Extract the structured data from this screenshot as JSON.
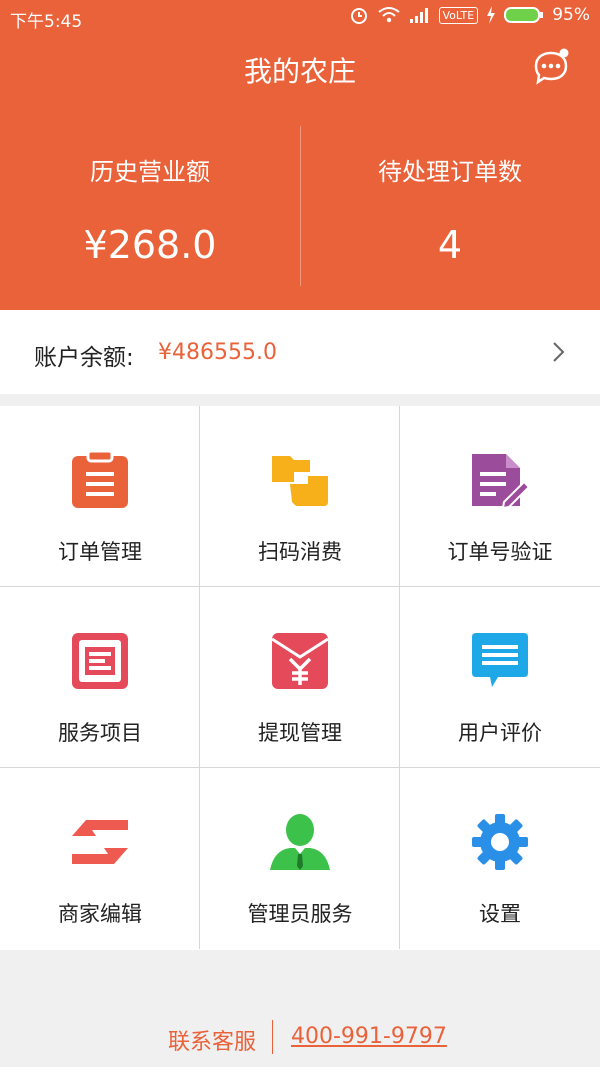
{
  "status_bar": {
    "time": "下午5:45",
    "network": "VoLTE",
    "battery": "95%"
  },
  "header": {
    "title": "我的农庄",
    "stats": [
      {
        "label": "历史营业额",
        "value": "¥268.0"
      },
      {
        "label": "待处理订单数",
        "value": "4"
      }
    ]
  },
  "balance": {
    "label": "账户余额:",
    "value": "¥486555.0"
  },
  "menu": [
    {
      "label": "订单管理",
      "icon": "clipboard-icon",
      "color": "#e9623a"
    },
    {
      "label": "扫码消费",
      "icon": "scan-folder-icon",
      "color": "#f8b01a"
    },
    {
      "label": "订单号验证",
      "icon": "document-edit-icon",
      "color": "#9b4d9c"
    },
    {
      "label": "服务项目",
      "icon": "service-list-icon",
      "color": "#e44a5a"
    },
    {
      "label": "提现管理",
      "icon": "yuan-envelope-icon",
      "color": "#e44a5a"
    },
    {
      "label": "用户评价",
      "icon": "comment-bubble-icon",
      "color": "#1fa8e8"
    },
    {
      "label": "商家编辑",
      "icon": "swap-arrows-icon",
      "color": "#ef5a50"
    },
    {
      "label": "管理员服务",
      "icon": "admin-user-icon",
      "color": "#3cc24a"
    },
    {
      "label": "设置",
      "icon": "gear-icon",
      "color": "#2a8fe6"
    }
  ],
  "footer": {
    "label": "联系客服",
    "phone": "400-991-9797"
  }
}
